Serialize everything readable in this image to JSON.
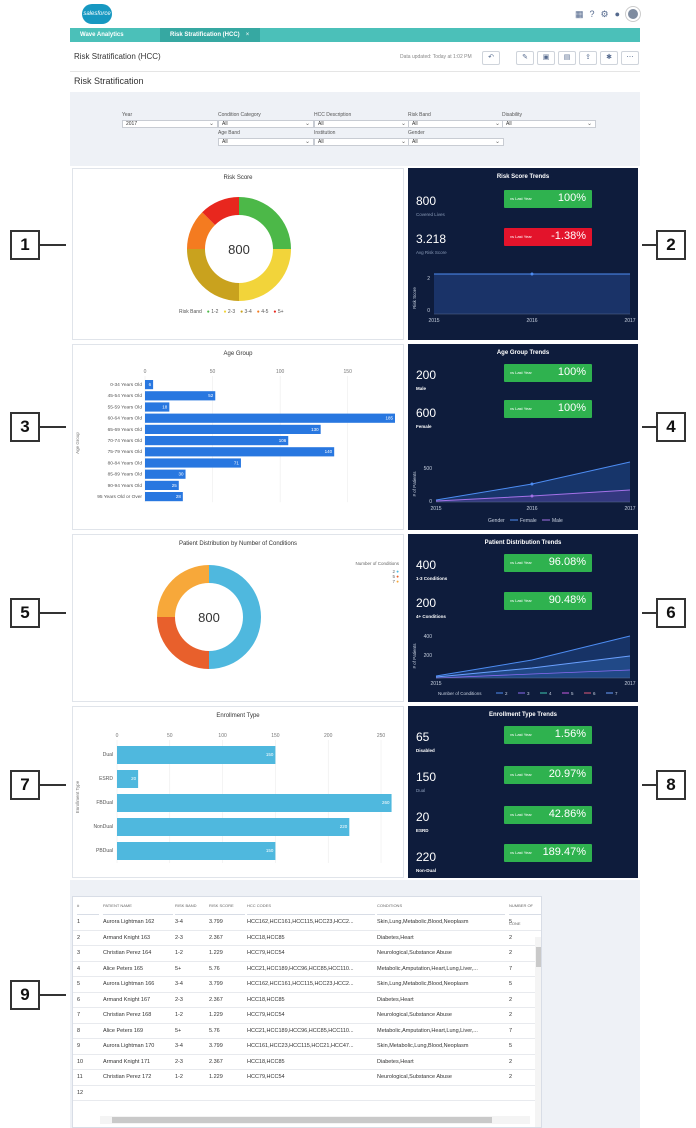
{
  "app": {
    "logo_text": "salesforce",
    "tab_app": "Wave Analytics",
    "tab_dashboard": "Risk Stratification (HCC)",
    "tab_close": "×"
  },
  "top_icons": {
    "apps": "▦",
    "help": "?",
    "settings": "⚙",
    "notifications": "●"
  },
  "header": {
    "title": "Risk Stratification (HCC)",
    "updated": "Data updated: Today at 1:02 PM",
    "buttons": [
      "↶",
      "✎",
      "▣",
      "▤",
      "⇪",
      "✱",
      "⋯"
    ]
  },
  "page_heading": "Risk Stratification",
  "filters": [
    {
      "label": "Year",
      "value": "2017"
    },
    {
      "label": "Condition Category",
      "value": "All"
    },
    {
      "label": "HCC Description",
      "value": "All"
    },
    {
      "label": "Risk Band",
      "value": "All"
    },
    {
      "label": "Disability",
      "value": "All"
    },
    {
      "label": "Age Band",
      "value": "All"
    },
    {
      "label": "Institution",
      "value": "All"
    },
    {
      "label": "Gender",
      "value": "All"
    }
  ],
  "colors": {
    "green": "#4cb848",
    "yellow": "#f2d43a",
    "olive": "#c9a21e",
    "orange": "#f47b20",
    "red": "#e8271e",
    "blue": "#2877e0",
    "teal": "#4fb8de",
    "navy": "#0e1c3c",
    "badge_green": "#2fb24f",
    "badge_red": "#e3132b"
  },
  "risk_score": {
    "title": "Risk Score",
    "center": "800",
    "legend_title": "Risk Band",
    "legend": [
      "1-2",
      "2-3",
      "3-4",
      "4-5",
      "5+"
    ]
  },
  "risk_trends": {
    "title": "Risk Score Trends",
    "covered_value": "800",
    "covered_label": "Covered Lives",
    "avg_value": "3.218",
    "avg_label": "Avg Risk Score",
    "badge1_label": "vs Last Year",
    "badge1_value": "100%",
    "badge2_label": "vs Last Year",
    "badge2_value": "-1.38%",
    "ylabel": "Risk Score",
    "yticks": [
      "2",
      "0"
    ],
    "xticks": [
      "2015",
      "2016",
      "2017"
    ]
  },
  "age_group": {
    "title": "Age Group",
    "ylabel": "Age Group",
    "xticks": [
      "0",
      "50",
      "100",
      "150"
    ],
    "categories": [
      "0-34 Years Old",
      "45-54 Years Old",
      "55-59 Years Old",
      "60-64 Years Old",
      "65-69 Years Old",
      "70-74 Years Old",
      "75-79 Years Old",
      "80-84 Years Old",
      "85-89 Years Old",
      "90-94 Years Old",
      "95 Years Old or Over"
    ],
    "values": [
      "6",
      "52",
      "18",
      "185",
      "130",
      "106",
      "140",
      "71",
      "30",
      "25",
      "28"
    ]
  },
  "age_trends": {
    "title": "Age Group Trends",
    "male_value": "200",
    "male_label": "Male",
    "female_value": "600",
    "female_label": "Female",
    "badge1_label": "vs Last Year",
    "badge1_value": "100%",
    "badge2_label": "vs Last Year",
    "badge2_value": "100%",
    "ylabel": "# of Patients",
    "yticks": [
      "500",
      "0"
    ],
    "xticks": [
      "2015",
      "2016",
      "2017"
    ],
    "legend_title": "Gender",
    "legend": [
      "Female",
      "Male"
    ]
  },
  "patient_dist": {
    "title": "Patient Distribution by Number of Conditions",
    "center": "800",
    "legend_title": "Number of Conditions",
    "legend": [
      "2",
      "5",
      "7"
    ]
  },
  "dist_trends": {
    "title": "Patient Distribution Trends",
    "v1": "400",
    "l1": "1-3 Conditions",
    "v2": "200",
    "l2": "4+ Conditions",
    "badge1_label": "vs Last Year",
    "badge1_value": "96.08%",
    "badge2_label": "vs Last Year",
    "badge2_value": "90.48%",
    "ylabel": "# of Patients",
    "yticks": [
      "400",
      "200",
      "0"
    ],
    "xticks": [
      "2015",
      "2016",
      "2017"
    ],
    "legend_title": "Number of Conditions",
    "legend": [
      "2",
      "3",
      "4",
      "5",
      "6",
      "7"
    ]
  },
  "enrollment": {
    "title": "Enrollment Type",
    "ylabel": "Enrollment Type",
    "xticks": [
      "0",
      "50",
      "100",
      "150",
      "200",
      "250"
    ],
    "categories": [
      "Dual",
      "ESRD",
      "FBDual",
      "NonDual",
      "PBDual"
    ],
    "values": [
      "150",
      "20",
      "260",
      "220",
      "150"
    ]
  },
  "enroll_trends": {
    "title": "Enrollment Type Trends",
    "rows": [
      {
        "value": "65",
        "label": "Disabled",
        "badge_label": "vs Last Year",
        "badge_value": "1.56%"
      },
      {
        "value": "150",
        "label": "Dual",
        "badge_label": "vs Last Year",
        "badge_value": "20.97%"
      },
      {
        "value": "20",
        "label": "ESRD",
        "badge_label": "vs Last Year",
        "badge_value": "42.86%"
      },
      {
        "value": "220",
        "label": "Non-Dual",
        "badge_label": "vs Last Year",
        "badge_value": "189.47%"
      }
    ]
  },
  "table": {
    "headers": [
      "#",
      "PATIENT NAME",
      "RISK BAND",
      "RISK SCORE",
      "HCC CODES",
      "CONDITIONS",
      "NUMBER OF CONE"
    ],
    "rows": [
      [
        "1",
        "Aurora Lightman 162",
        "3-4",
        "3.799",
        "HCC162,HCC161,HCC115,HCC23,HCC2...",
        "Skin,Lung,Metabolic,Blood,Neoplasm",
        "5"
      ],
      [
        "2",
        "Armand Knight 163",
        "2-3",
        "2.367",
        "HCC18,HCC85",
        "Diabetes,Heart",
        "2"
      ],
      [
        "3",
        "Christian Perez 164",
        "1-2",
        "1.229",
        "HCC79,HCC54",
        "Neurological,Substance Abuse",
        "2"
      ],
      [
        "4",
        "Alice Peters 165",
        "5+",
        "5.76",
        "HCC21,HCC189,HCC96,HCC85,HCC110...",
        "Metabolic,Amputation,Heart,Lung,Liver,...",
        "7"
      ],
      [
        "5",
        "Aurora Lightman 166",
        "3-4",
        "3.799",
        "HCC162,HCC161,HCC115,HCC23,HCC2...",
        "Skin,Lung,Metabolic,Blood,Neoplasm",
        "5"
      ],
      [
        "6",
        "Armand Knight 167",
        "2-3",
        "2.367",
        "HCC18,HCC85",
        "Diabetes,Heart",
        "2"
      ],
      [
        "7",
        "Christian Perez 168",
        "1-2",
        "1.229",
        "HCC79,HCC54",
        "Neurological,Substance Abuse",
        "2"
      ],
      [
        "8",
        "Alice Peters 169",
        "5+",
        "5.76",
        "HCC21,HCC189,HCC96,HCC85,HCC110...",
        "Metabolic,Amputation,Heart,Lung,Liver,...",
        "7"
      ],
      [
        "9",
        "Aurora Lightman 170",
        "3-4",
        "3.799",
        "HCC161,HCC23,HCC115,HCC21,HCC47...",
        "Skin,Metabolic,Lung,Blood,Neoplasm",
        "5"
      ],
      [
        "10",
        "Armand Knight 171",
        "2-3",
        "2.367",
        "HCC18,HCC85",
        "Diabetes,Heart",
        "2"
      ],
      [
        "11",
        "Christian Perez 172",
        "1-2",
        "1.229",
        "HCC79,HCC54",
        "Neurological,Substance Abuse",
        "2"
      ],
      [
        "12",
        "",
        "",
        "",
        "",
        "",
        ""
      ]
    ]
  },
  "callouts": [
    "1",
    "2",
    "3",
    "4",
    "5",
    "6",
    "7",
    "8",
    "9"
  ]
}
